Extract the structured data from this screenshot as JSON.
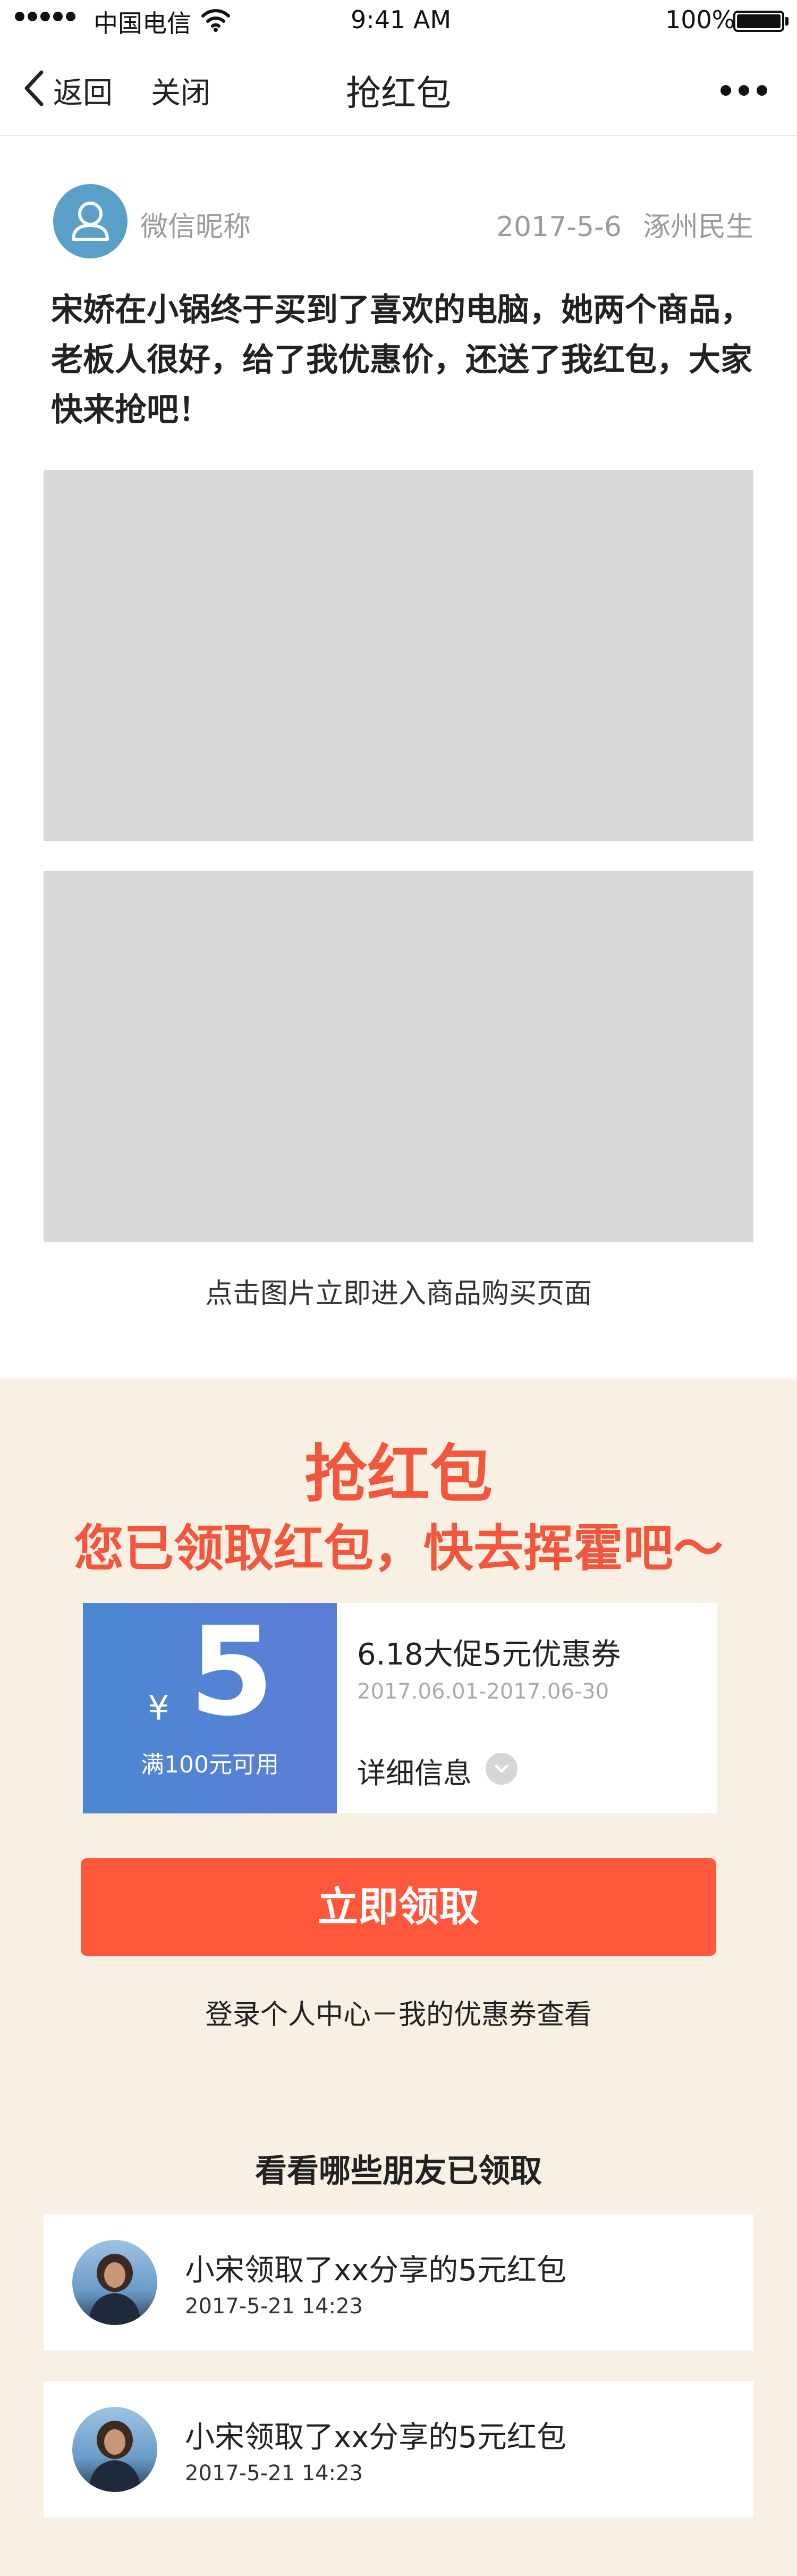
{
  "status_bar": {
    "carrier": "中国电信",
    "time": "9:41 AM",
    "battery": "100%"
  },
  "nav": {
    "back_label": "返回",
    "close_label": "关闭",
    "title": "抢红包",
    "more_icon": "more-dots-icon"
  },
  "post": {
    "nickname": "微信昵称",
    "date": "2017-5-6",
    "location": "涿州民生",
    "text": "宋娇在小锅终于买到了喜欢的电脑，她两个商品，老板人很好，给了我优惠价，还送了我红包，大家快来抢吧！",
    "image_tip": "点击图片立即进入商品购买页面"
  },
  "promo": {
    "title": "抢红包",
    "subtitle": "您已领取红包，快去挥霍吧～",
    "coupon": {
      "currency": "¥",
      "amount": "5",
      "condition": "满100元可用",
      "name": "6.18大促5元优惠券",
      "period": "2017.06.01-2017.06-30",
      "detail_label": "详细信息"
    },
    "claim_button": "立即领取",
    "login_tip": "登录个人中心－我的优惠券查看"
  },
  "friends": {
    "title": "看看哪些朋友已领取",
    "items": [
      {
        "text": "小宋领取了xx分享的5元红包",
        "time": "2017-5-21  14:23"
      },
      {
        "text": "小宋领取了xx分享的5元红包",
        "time": "2017-5-21  14:23"
      }
    ]
  },
  "colors": {
    "accent": "#f2563c",
    "button": "#ff573c",
    "promo_bg": "#f8f0e2",
    "coupon_blue": "#4a89d2"
  }
}
